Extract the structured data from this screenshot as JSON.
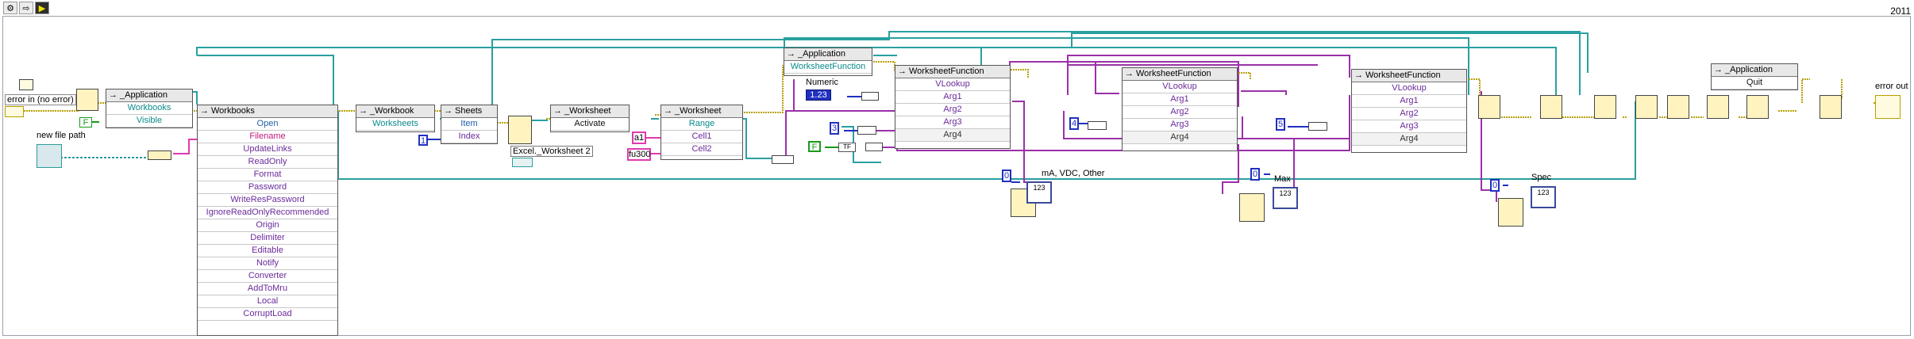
{
  "toolbar": {
    "buttons": [
      "⚙",
      "⇨",
      "▶"
    ],
    "frame_label": "2011"
  },
  "terminals": {
    "error_in": "error in (no error)",
    "error_out": "error out",
    "new_file_path": "new file path"
  },
  "nodes": {
    "app_open": {
      "title": "_Application",
      "props": [
        "Workbooks",
        "Visible"
      ]
    },
    "workbooks": {
      "title": "Workbooks",
      "props": [
        "Open",
        "Filename",
        "UpdateLinks",
        "ReadOnly",
        "Format",
        "Password",
        "WriteResPassword",
        "IgnoreReadOnlyRecommended",
        "Origin",
        "Delimiter",
        "Editable",
        "Notify",
        "Converter",
        "AddToMru",
        "Local",
        "CorruptLoad"
      ]
    },
    "workbook": {
      "title": "_Workbook",
      "props": [
        "Worksheets"
      ]
    },
    "sheets": {
      "title": "Sheets",
      "props": [
        "Item",
        "Index"
      ]
    },
    "worksheet_activate": {
      "title": "_Worksheet",
      "props": [
        "Activate"
      ]
    },
    "worksheet_range": {
      "title": "_Worksheet",
      "props": [
        "Range",
        "Cell1",
        "Cell2"
      ]
    },
    "app_wsf": {
      "title": "_Application",
      "props": [
        "WorksheetFunction"
      ]
    },
    "wsf1": {
      "title": "WorksheetFunction",
      "props": [
        "VLookup",
        "Arg1",
        "Arg2",
        "Arg3",
        "Arg4"
      ]
    },
    "wsf2": {
      "title": "WorksheetFunction",
      "props": [
        "VLookup",
        "Arg1",
        "Arg2",
        "Arg3",
        "Arg4"
      ]
    },
    "wsf3": {
      "title": "WorksheetFunction",
      "props": [
        "VLookup",
        "Arg1",
        "Arg2",
        "Arg3",
        "Arg4"
      ]
    },
    "app_quit": {
      "title": "_Application",
      "props": [
        "Quit"
      ]
    }
  },
  "labels": {
    "excel_worksheet": "Excel._Worksheet 2",
    "numeric": "Numeric",
    "ma_vdc_other": "mA, VDC, Other",
    "max": "Max",
    "spec": "Spec"
  },
  "constants": {
    "one": "1",
    "a1": "a1",
    "fu300": "fu300",
    "three": "3",
    "four": "4",
    "five": "5",
    "zero_a": "0",
    "zero_b": "0",
    "zero_c": "0",
    "f": "F",
    "tf": "TF",
    "numeric_val": "1.23",
    "ind_val": "123"
  },
  "colors": {
    "refnum_wire": "#2aa0a0",
    "variant_wire": "#9b30a8",
    "error_wire": "#b8a000",
    "path_wire": "#2a9a9a",
    "string_wire": "#e03aae",
    "numeric_wire": "#2030c0"
  }
}
